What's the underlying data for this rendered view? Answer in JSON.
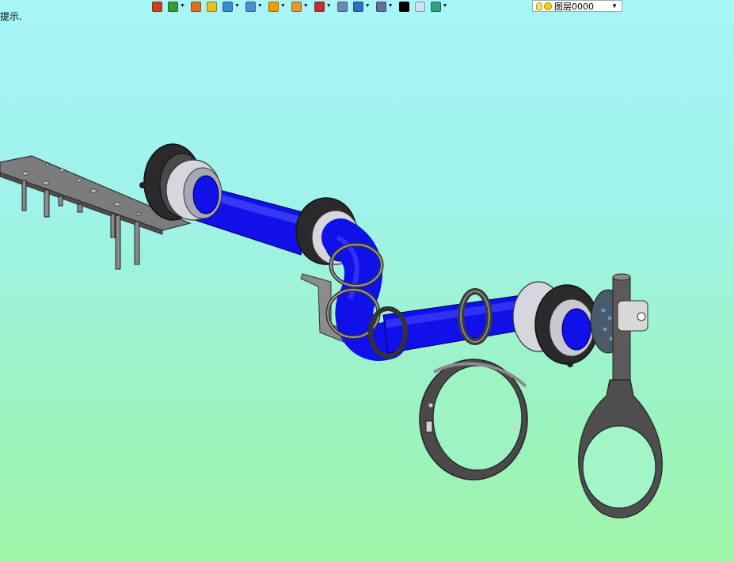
{
  "status": {
    "hint": "提示."
  },
  "toolbar": {
    "buttons": [
      {
        "name": "exit-icon",
        "color": "#d04020",
        "dropdown": false
      },
      {
        "name": "layers-icon",
        "color": "#3a9a3a",
        "dropdown": true
      },
      {
        "name": "pencil-icon",
        "color": "#e07020",
        "dropdown": false
      },
      {
        "name": "box-yellow-icon",
        "color": "#e8c020",
        "dropdown": false
      },
      {
        "name": "box-blue-icon",
        "color": "#3a8ad0",
        "dropdown": true
      },
      {
        "name": "view-cube-icon",
        "color": "#4a90d0",
        "dropdown": true
      },
      {
        "name": "render-icon",
        "color": "#f0a000",
        "dropdown": true
      },
      {
        "name": "camera-icon",
        "color": "#e09a30",
        "dropdown": true
      },
      {
        "name": "target-icon",
        "color": "#c03030",
        "dropdown": true
      },
      {
        "name": "page-icon",
        "color": "#6a8ab0",
        "dropdown": false
      },
      {
        "name": "column-icon",
        "color": "#3070c0",
        "dropdown": true
      },
      {
        "name": "monitor-icon",
        "color": "#6070a0",
        "dropdown": true
      },
      {
        "name": "line-color-icon",
        "color": "#000000",
        "dropdown": false
      },
      {
        "name": "fill-icon",
        "color": "#cfe4f2",
        "dropdown": false
      },
      {
        "name": "layer-stack-icon",
        "color": "#30a080",
        "dropdown": true
      }
    ]
  },
  "layer": {
    "current": "图层0000"
  },
  "colors": {
    "pipe": "#1010e8",
    "part_dark": "#3a3a3a",
    "part_grey": "#8a8a8a",
    "ring_light": "#d8d8e0"
  }
}
